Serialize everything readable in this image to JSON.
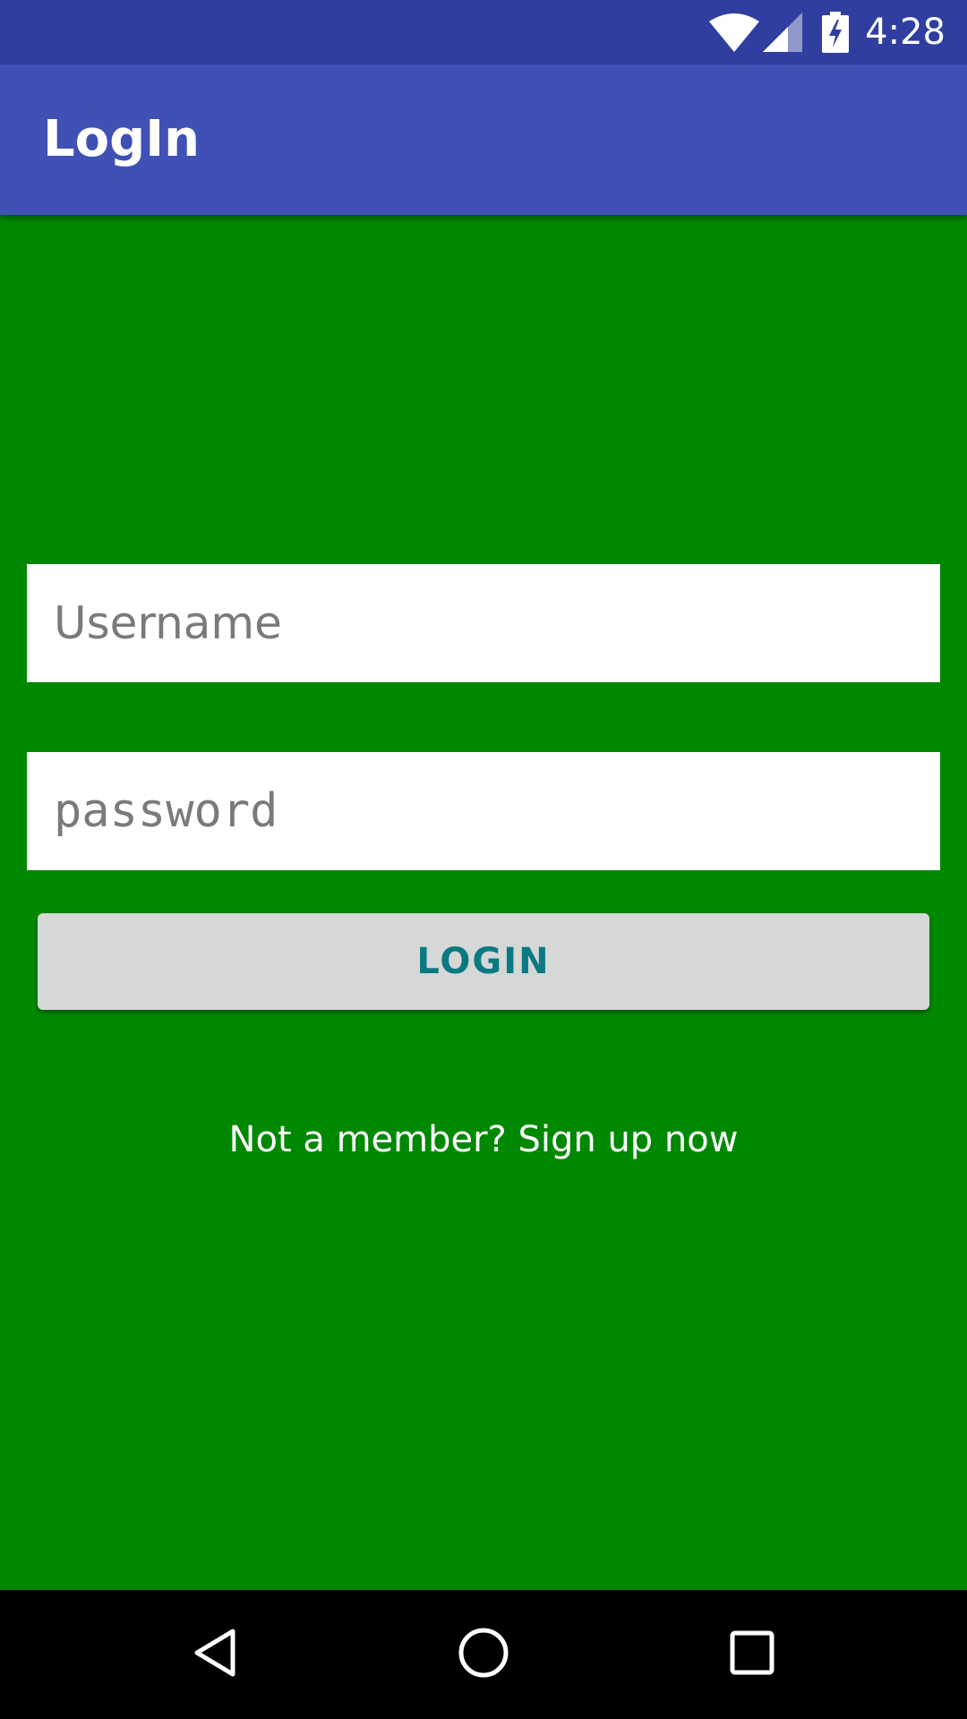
{
  "status_bar": {
    "time": "4:28",
    "icons": [
      "wifi-icon",
      "cellular-signal-icon",
      "battery-charging-icon"
    ]
  },
  "app_bar": {
    "title": "LogIn"
  },
  "form": {
    "username_placeholder": "Username",
    "username_value": "",
    "password_placeholder": "password",
    "password_value": "",
    "login_label": "LOGIN",
    "signup_text": "Not a member? Sign up now"
  },
  "nav_bar": {
    "buttons": [
      "back-icon",
      "home-icon",
      "recents-icon"
    ]
  },
  "colors": {
    "status_bar": "#303F9F",
    "app_bar": "#3F51B5",
    "background": "#008800",
    "button": "#D6D7D7",
    "button_text": "#0A7A82"
  }
}
